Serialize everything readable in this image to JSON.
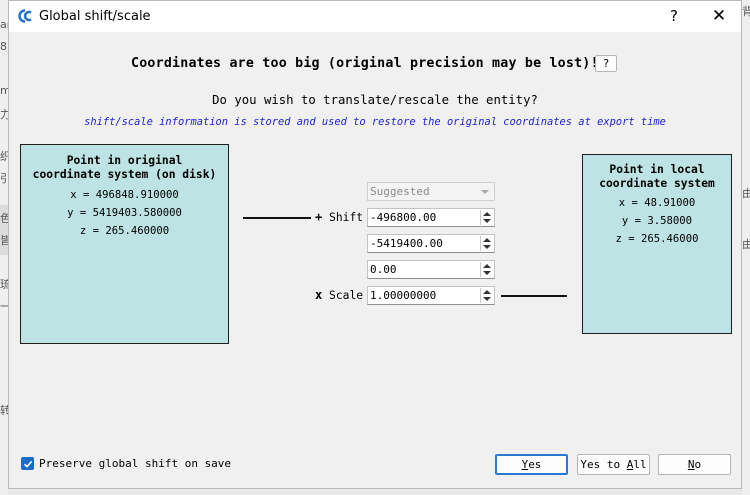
{
  "window": {
    "title": "Global shift/scale"
  },
  "titlebar": {
    "help_label": "?",
    "close_label": "✕"
  },
  "headline": "Coordinates are too big (original precision may be lost)!",
  "headline_help_label": "?",
  "question": "Do you wish to translate/rescale the entity?",
  "info": "shift/scale information is stored and used to restore the original coordinates at export time",
  "original_box": {
    "title_line1": "Point in original",
    "title_line2": "coordinate system (on disk)",
    "x": "x = 496848.910000",
    "y": "y = 5419403.580000",
    "z": "z = 265.460000"
  },
  "local_box": {
    "title_line1": "Point in local",
    "title_line2": "coordinate system",
    "x": "x = 48.91000",
    "y": "y = 3.58000",
    "z": "z = 265.46000"
  },
  "shift": {
    "sign": "+",
    "label": "Shift",
    "preset": "Suggested",
    "x": "-496800.00",
    "y": "-5419400.00",
    "z": "0.00"
  },
  "scale": {
    "sign": "x",
    "label": "Scale",
    "value": "1.00000000"
  },
  "preserve": {
    "checked": true,
    "label": "Preserve global shift on save"
  },
  "buttons": {
    "yes": {
      "underline": "Y",
      "rest": "es"
    },
    "yes_to_all": {
      "before": "Yes to ",
      "underline": "A",
      "rest": "ll"
    },
    "no": {
      "underline": "N",
      "rest": "o"
    }
  },
  "background": {
    "left_glyphs": [
      "ar",
      "8",
      "m",
      "力",
      "织",
      "引",
      "色",
      "皆",
      "琉",
      "一",
      "转"
    ],
    "right_glyphs": [
      "背",
      "由",
      "由"
    ]
  },
  "colors": {
    "box_fill": "#bde3e4",
    "info_text": "#1f1fcf",
    "accent": "#1a6cc5"
  }
}
